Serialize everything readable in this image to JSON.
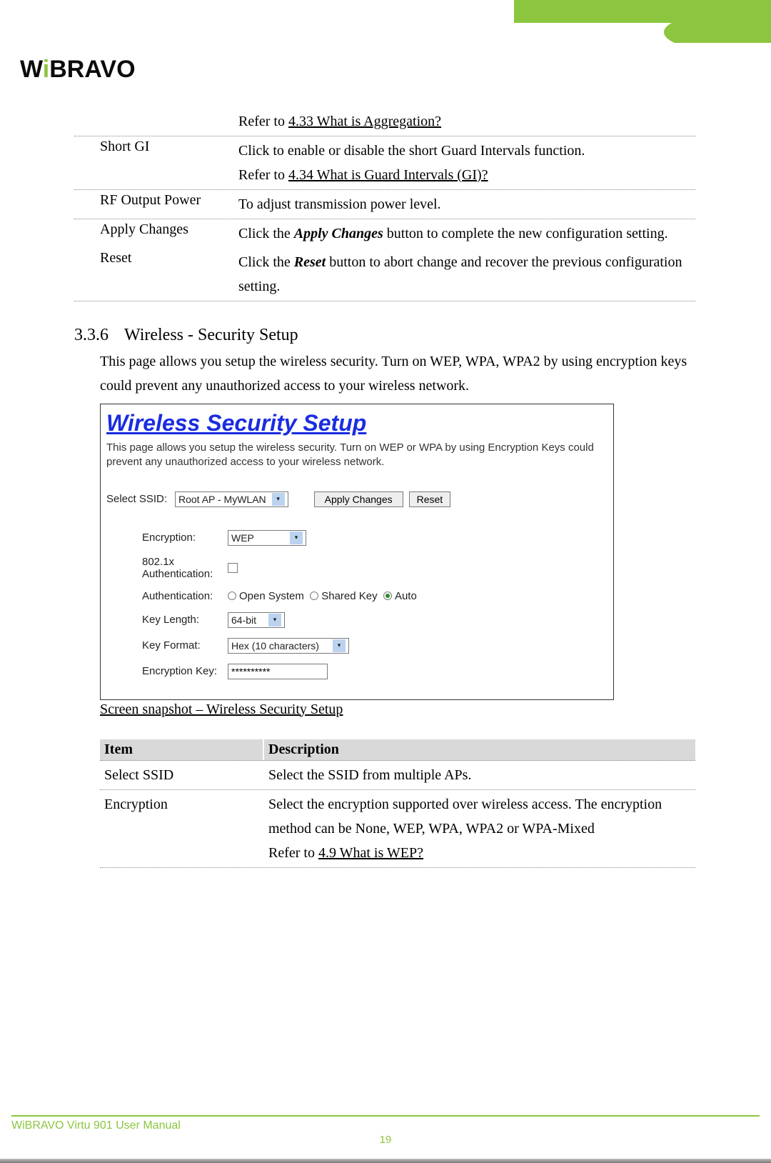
{
  "brand": {
    "logo_text": "WiBRAVO"
  },
  "table1": {
    "row0_desc_prefix": "Refer to ",
    "row0_link": "4.33 What is Aggregation?",
    "row1_item": "Short GI",
    "row1_desc_a": "Click to enable or disable the short Guard Intervals function.",
    "row1_desc_b_prefix": "Refer to ",
    "row1_desc_b_link": "4.34 What is Guard Intervals (GI)?",
    "row2_item": "RF Output Power",
    "row2_desc": "To adjust transmission power level.",
    "row3_item": "Apply Changes",
    "row3_desc_a": "Click the ",
    "row3_desc_bold": "Apply Changes",
    "row3_desc_b": " button to complete the new configuration setting.",
    "row4_item": "Reset",
    "row4_desc_a": "Click the ",
    "row4_desc_bold": "Reset",
    "row4_desc_b": " button to abort change and recover the previous configuration setting."
  },
  "section": {
    "num": "3.3.6",
    "title": "Wireless - Security Setup",
    "desc": "This page allows you setup the wireless security. Turn on WEP, WPA, WPA2 by using encryption keys could prevent any unauthorized access to your wireless network."
  },
  "screenshot": {
    "title": "Wireless Security Setup",
    "subtext": "This page allows you setup the wireless security. Turn on WEP or WPA by using Encryption Keys could prevent any unauthorized access to your wireless network.",
    "select_ssid_label": "Select SSID:",
    "select_ssid_value": "Root AP - MyWLAN",
    "apply_btn": "Apply Changes",
    "reset_btn": "Reset",
    "encryption_label": "Encryption:",
    "encryption_value": "WEP",
    "auth8021x_label": "802.1x Authentication:",
    "authentication_label": "Authentication:",
    "auth_opt1": "Open System",
    "auth_opt2": "Shared Key",
    "auth_opt3": "Auto",
    "keylen_label": "Key Length:",
    "keylen_value": "64-bit",
    "keyfmt_label": "Key Format:",
    "keyfmt_value": "Hex (10 characters)",
    "enckey_label": "Encryption Key:",
    "enckey_value": "**********"
  },
  "caption": "Screen snapshot – Wireless Security Setup",
  "table2": {
    "hdr_item": "Item",
    "hdr_desc": "Description",
    "r1_item": "Select SSID",
    "r1_desc": "Select the SSID from multiple APs.",
    "r2_item": "Encryption",
    "r2_desc_a": "Select the encryption supported over wireless access. The encryption method can be None, WEP, WPA, WPA2 or WPA-Mixed",
    "r2_desc_b_prefix": "Refer to ",
    "r2_desc_b_link": "4.9 What is WEP?"
  },
  "footer": {
    "text": "WiBRAVO Virtu 901 User Manual",
    "page": "19"
  }
}
